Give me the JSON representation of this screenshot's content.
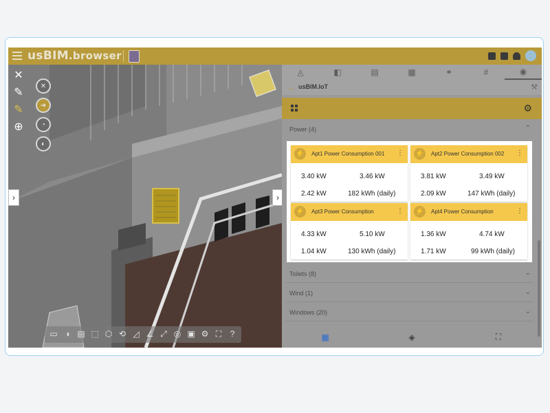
{
  "app": {
    "logo_main": "usBIM",
    "logo_suffix": ".browser"
  },
  "panel": {
    "iot_title": "usBIM.IoT",
    "groups": [
      {
        "label": "Power (4)"
      },
      {
        "label": "Toilets (8)"
      },
      {
        "label": "Wind (1)"
      },
      {
        "label": "Windows (20)"
      }
    ]
  },
  "cards": [
    {
      "title": "Apt1 Power Consumption 001",
      "v1": "3.40 kW",
      "v2": "3.46 kW",
      "v3": "2.42 kW",
      "v4": "182 kWh (daily)"
    },
    {
      "title": "Apt2 Power Consumption 002",
      "v1": "3.81 kW",
      "v2": "3.49 kW",
      "v3": "2.09 kW",
      "v4": "147 kWh (daily)"
    },
    {
      "title": "Apt3 Power Consumption",
      "v1": "4.33 kW",
      "v2": "5.10 kW",
      "v3": "1.04 kW",
      "v4": "130 kWh (daily)"
    },
    {
      "title": "Apt4 Power Consumption",
      "v1": "1.36 kW",
      "v2": "4.74 kW",
      "v3": "1.71 kW",
      "v4": "99 kWh (daily)"
    }
  ],
  "colors": {
    "accent": "#f5c84c",
    "topbar": "#b89a3a",
    "frame_border": "#9fd2ee"
  }
}
